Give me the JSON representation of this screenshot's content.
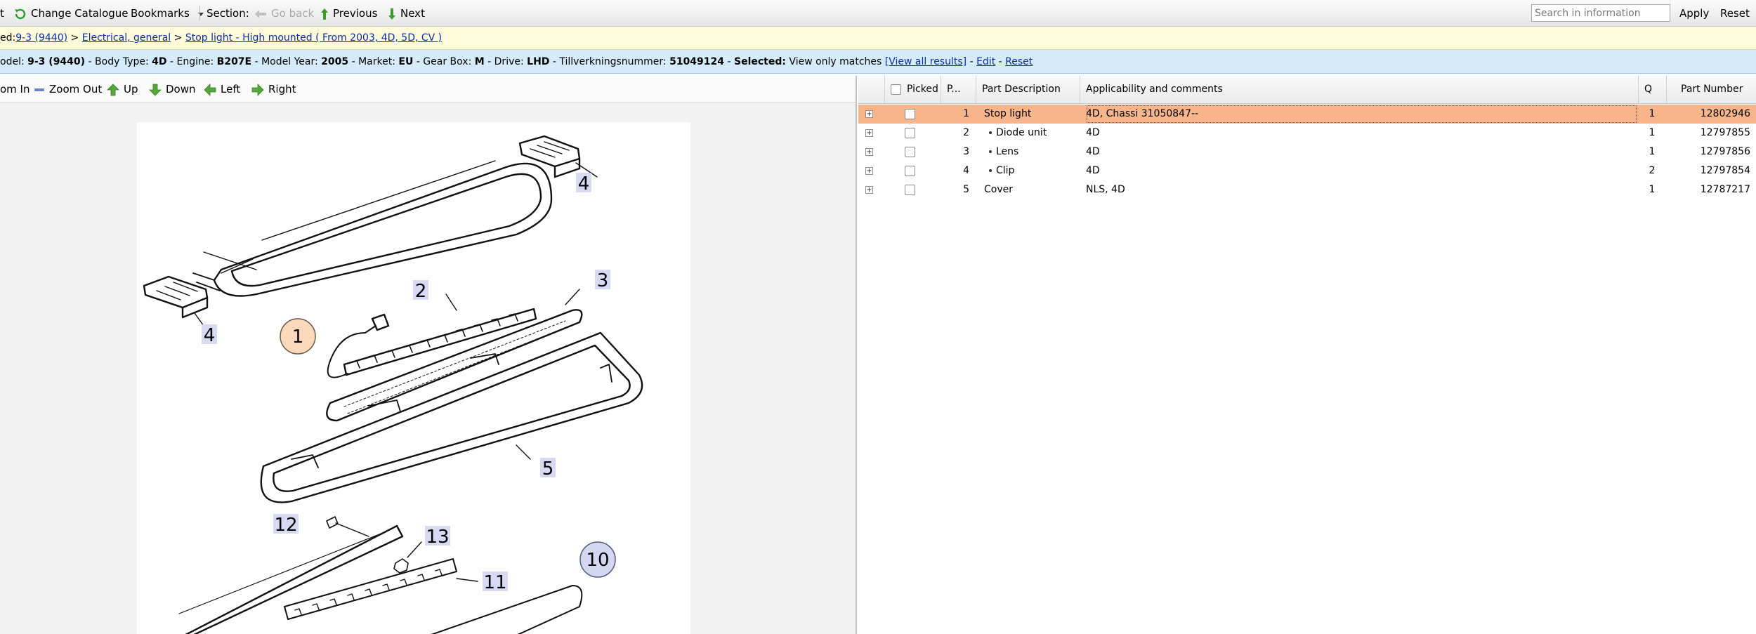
{
  "toolbar": {
    "cut_left": "t",
    "change_catalogue": "Change Catalogue",
    "bookmarks": "Bookmarks",
    "section": "Section:",
    "go_back": "Go back",
    "previous": "Previous",
    "next": "Next",
    "search_placeholder": "Search in information",
    "apply": "Apply",
    "reset": "Reset"
  },
  "breadcrumb": {
    "prefix": "ed:",
    "items": [
      "9-3 (9440)",
      "Electrical, general",
      "Stop light - High mounted ( From 2003, 4D, 5D, CV )"
    ],
    "sep": ">"
  },
  "model_bar": {
    "model_label": "odel:",
    "model_value": "9-3 (9440)",
    "body_label": "Body Type:",
    "body_value": "4D",
    "engine_label": "Engine:",
    "engine_value": "B207E",
    "year_label": "Model Year:",
    "year_value": "2005",
    "market_label": "Market:",
    "market_value": "EU",
    "gearbox_label": "Gear Box:",
    "gearbox_value": "M",
    "drive_label": "Drive:",
    "drive_value": "LHD",
    "chassis_label": "Tillverkningsnummer:",
    "chassis_value": "51049124",
    "selected_label": "Selected:",
    "selected_value": "View only matches",
    "view_all": "[View all results]",
    "edit": "Edit",
    "reset": "Reset",
    "dash": "-"
  },
  "diagram_tools": {
    "zoom_in": "om In",
    "zoom_out": "Zoom Out",
    "up": "Up",
    "down": "Down",
    "left": "Left",
    "right": "Right"
  },
  "diagram": {
    "callouts": [
      "1",
      "2",
      "3",
      "4",
      "4",
      "5",
      "10",
      "11",
      "12",
      "13"
    ]
  },
  "table": {
    "headers": [
      "Picked",
      "P...",
      "Part Description",
      "Applicability and comments",
      "Q",
      "Part Number"
    ],
    "rows": [
      {
        "pos": "1",
        "desc": "Stop light",
        "bullet": false,
        "applic": "4D, Chassi 31050847--",
        "qty": "1",
        "part": "12802946",
        "selected": true
      },
      {
        "pos": "2",
        "desc": "Diode unit",
        "bullet": true,
        "applic": "4D",
        "qty": "1",
        "part": "12797855",
        "selected": false
      },
      {
        "pos": "3",
        "desc": "Lens",
        "bullet": true,
        "applic": "4D",
        "qty": "1",
        "part": "12797856",
        "selected": false
      },
      {
        "pos": "4",
        "desc": "Clip",
        "bullet": true,
        "applic": "4D",
        "qty": "2",
        "part": "12797854",
        "selected": false
      },
      {
        "pos": "5",
        "desc": "Cover",
        "bullet": false,
        "applic": "NLS, 4D",
        "qty": "1",
        "part": "12787217",
        "selected": false
      }
    ]
  },
  "colors": {
    "selected_row": "#f8b58b",
    "model_bar_bg": "#d5ebfa",
    "breadcrumb_bg": "#fdfbd9",
    "link": "#0b2ea8",
    "callout_selected": "#fbd9bd",
    "callout_circle": "#d4d6f2",
    "callout_label": "#d8daf4"
  }
}
